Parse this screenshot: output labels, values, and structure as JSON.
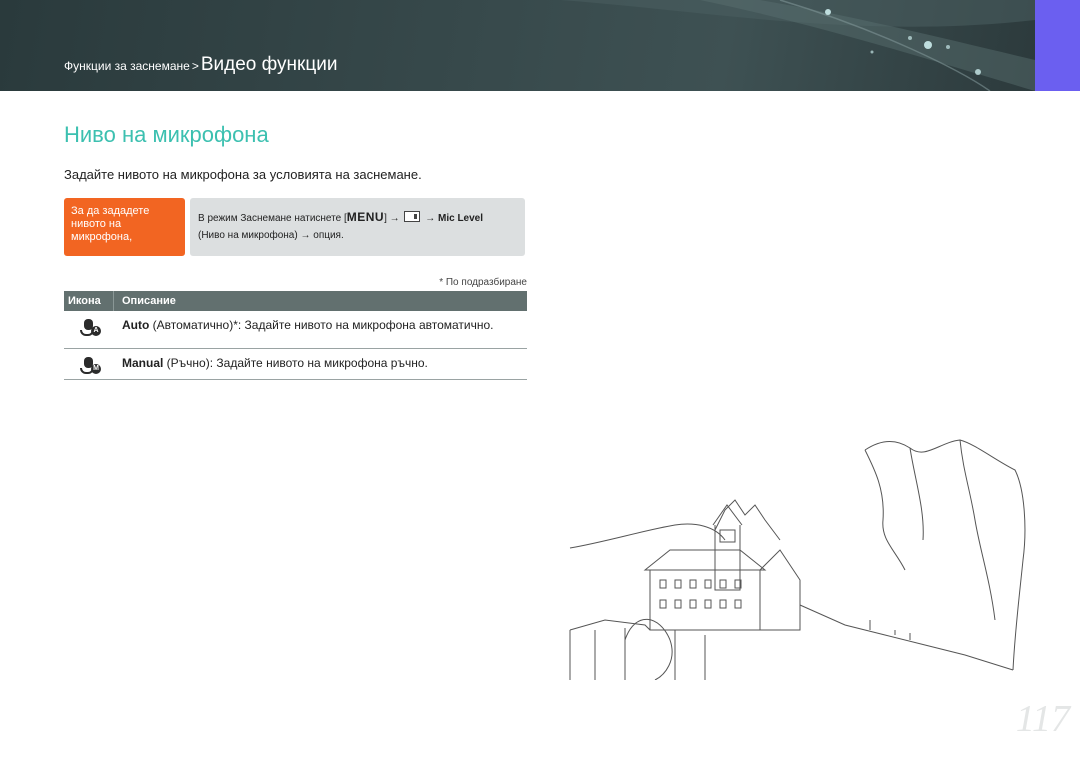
{
  "header": {
    "breadcrumb_parent": "Функции за заснемане",
    "breadcrumb_sep": ">",
    "breadcrumb_current": "Видео функции",
    "accent_color": "#6b5ff0"
  },
  "section": {
    "title": "Ниво на микрофона",
    "intro": "Задайте нивото на микрофона за условията на заснемане."
  },
  "tip": {
    "label": "За да зададете нивото на микрофона,",
    "color": "#f26522"
  },
  "steps": {
    "prefix": "В режим Заснемане натиснете [",
    "menu_key": "MENU",
    "suffix_bracket": "] →",
    "arrow1": "→",
    "mic_level": "Mic Level",
    "line2": "(Ниво на микрофона) → опция."
  },
  "default_note": "* По подразбиране",
  "table": {
    "col_icon": "Икона",
    "col_desc": "Описание",
    "rows": [
      {
        "icon": "mic-auto-icon",
        "badge": "A",
        "keyword": "Auto",
        "text": " (Автоматично)*: Задайте нивото на микрофона автоматично."
      },
      {
        "icon": "mic-manual-icon",
        "badge": "M",
        "keyword": "Manual",
        "text": " (Ръчно): Задайте нивото на микрофона ръчно."
      }
    ]
  },
  "page_number": "117"
}
